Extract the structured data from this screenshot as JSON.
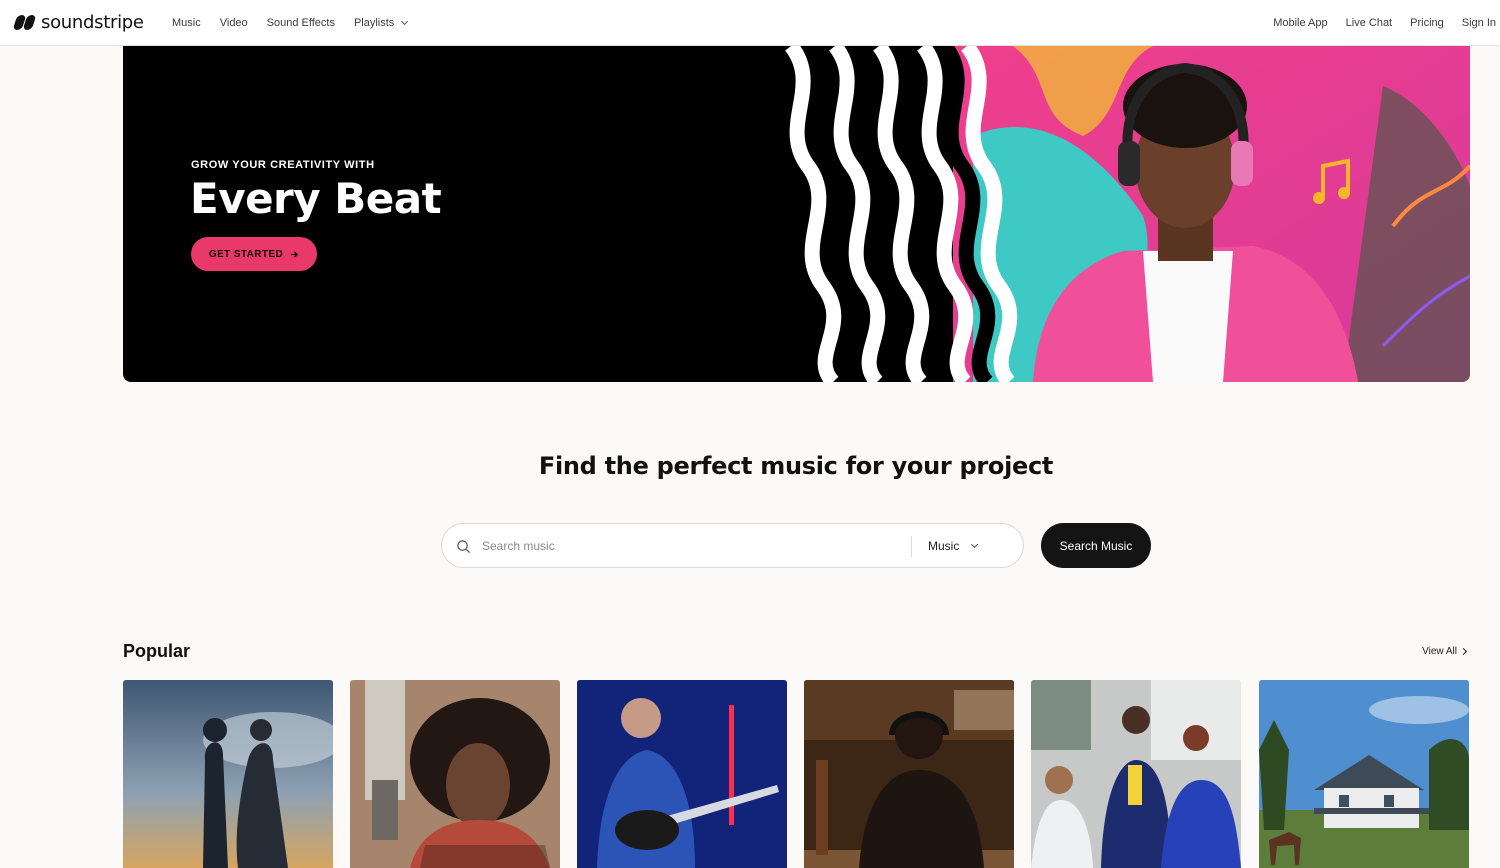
{
  "brand": {
    "name": "soundstripe"
  },
  "nav": {
    "left": [
      "Music",
      "Video",
      "Sound Effects"
    ],
    "playlists_label": "Playlists",
    "right": [
      "Mobile App",
      "Live Chat",
      "Pricing",
      "Sign In"
    ]
  },
  "hero": {
    "eyebrow": "GROW YOUR CREATIVITY WITH",
    "title": "Every Beat",
    "cta_label": "GET STARTED"
  },
  "search": {
    "heading": "Find the perfect music for your project",
    "placeholder": "Search music",
    "type_selected": "Music",
    "button_label": "Search Music"
  },
  "popular": {
    "title": "Popular",
    "view_all_label": "View All",
    "cards": [
      {
        "image": "wedding-couple-silhouette"
      },
      {
        "image": "singer-headphones-microphone"
      },
      {
        "image": "guitarist-blue-light"
      },
      {
        "image": "man-headphones-studio"
      },
      {
        "image": "office-team-meeting"
      },
      {
        "image": "farmhouse-with-horse"
      }
    ]
  },
  "colors": {
    "accent": "#e8396a",
    "dark": "#141414",
    "background": "#fbfaf8"
  }
}
